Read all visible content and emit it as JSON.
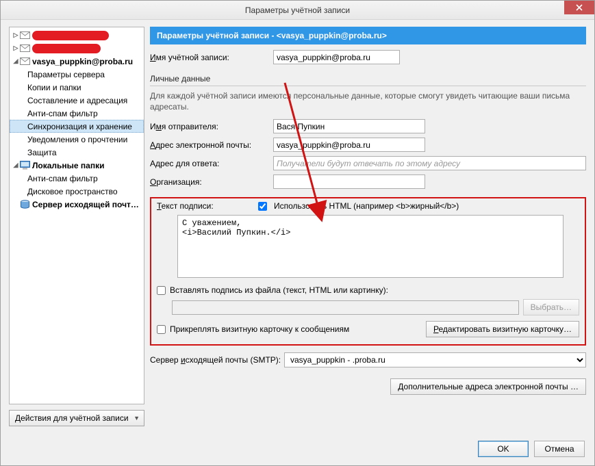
{
  "title": "Параметры учётной записи",
  "sidebar": {
    "accounts": [
      {
        "email": "vasya_puppkin@proba.ru"
      }
    ],
    "items": {
      "server_params": "Параметры сервера",
      "copies_folders": "Копии и папки",
      "compose_address": "Составление и адресация",
      "antispam": "Анти-спам фильтр",
      "sync_storage": "Синхронизация и хранение",
      "read_receipts": "Уведомления о прочтении",
      "security": "Защита",
      "local_folders": "Локальные папки",
      "antispam2": "Анти-спам фильтр",
      "disk_space": "Дисковое пространство",
      "outgoing_server": "Сервер исходящей почт…"
    },
    "actions_button": "Действия для учётной записи"
  },
  "header": "Параметры учётной записи - <vasya_puppkin@proba.ru>",
  "account_name": {
    "label": "Имя учётной записи:",
    "value": "vasya_puppkin@proba.ru"
  },
  "personal": {
    "title": "Личные данные",
    "desc": "Для каждой учётной записи имеются персональные данные, которые смогут увидеть читающие ваши письма адресаты.",
    "sender_name": {
      "label": "Имя отправителя:",
      "value": "Вася Пупкин"
    },
    "email": {
      "label": "Адрес электронной почты:",
      "value": "vasya_puppkin@proba.ru"
    },
    "reply_to": {
      "label": "Адрес для ответа:",
      "placeholder": "Получатели будут отвечать по этому адресу"
    },
    "organization": {
      "label": "Организация:",
      "value": ""
    }
  },
  "signature": {
    "label": "Текст подписи:",
    "use_html_label": "Использовать HTML (например <b>жирный</b>)",
    "text": "С уважением,\n<i>Василий Пупкин.</i>",
    "from_file_label": "Вставлять подпись из файла (текст, HTML или картинку):",
    "browse": "Выбрать…",
    "attach_vcard_label": "Прикреплять визитную карточку к сообщениям",
    "edit_vcard": "Редактировать визитную карточку…"
  },
  "smtp": {
    "label": "Сервер исходящей почты (SMTP):",
    "value": "vasya_puppkin - .proba.ru"
  },
  "extra_addresses_btn": "Дополнительные адреса электронной почты …",
  "buttons": {
    "ok": "OK",
    "cancel": "Отмена"
  }
}
